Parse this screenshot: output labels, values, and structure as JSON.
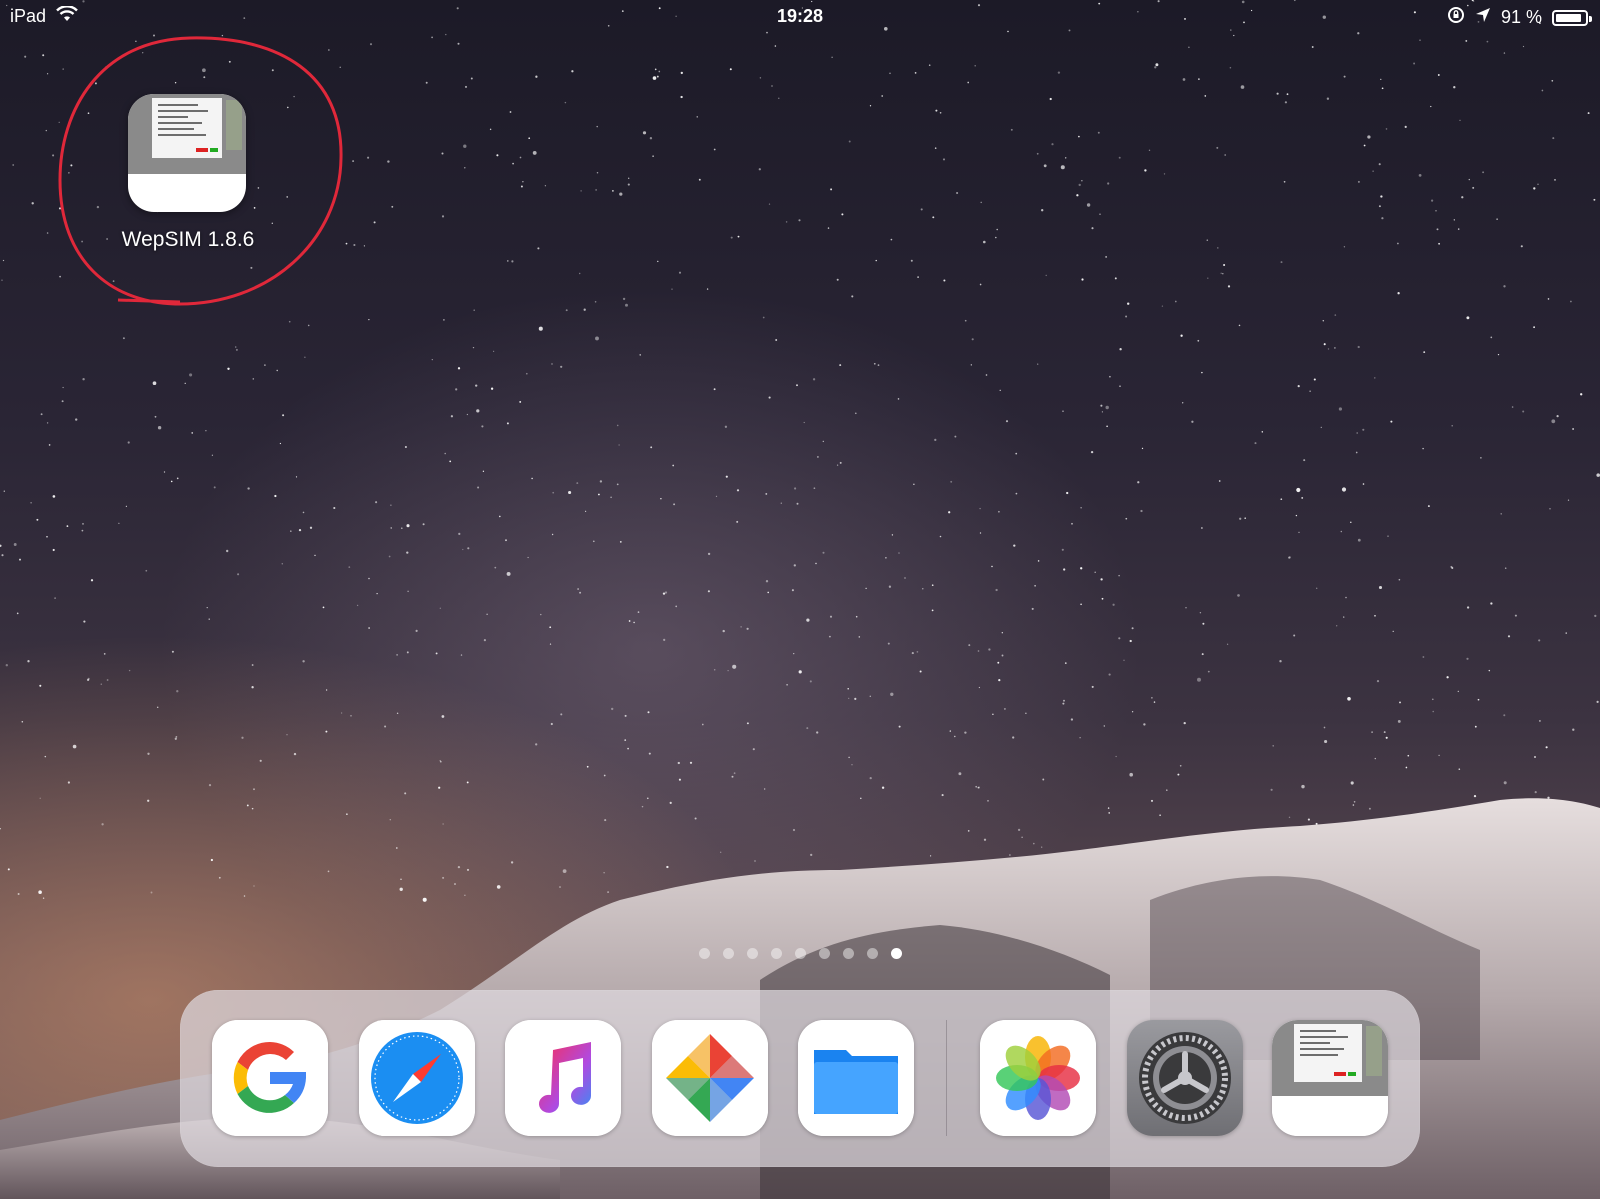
{
  "status_bar": {
    "device": "iPad",
    "time": "19:28",
    "battery_text": "91 %",
    "battery_level": 0.91
  },
  "home_app": {
    "label": "WepSIM 1.8.6",
    "annotation_color": "#e0283a"
  },
  "page_indicator": {
    "page_count": 9,
    "current_page": 9
  },
  "dock": {
    "apps": [
      {
        "name": "google-icon"
      },
      {
        "name": "safari-icon"
      },
      {
        "name": "music-icon"
      },
      {
        "name": "google-photos-icon"
      },
      {
        "name": "files-icon"
      },
      {
        "name": "photos-icon"
      },
      {
        "name": "settings-icon"
      },
      {
        "name": "wepsim-icon"
      }
    ]
  }
}
